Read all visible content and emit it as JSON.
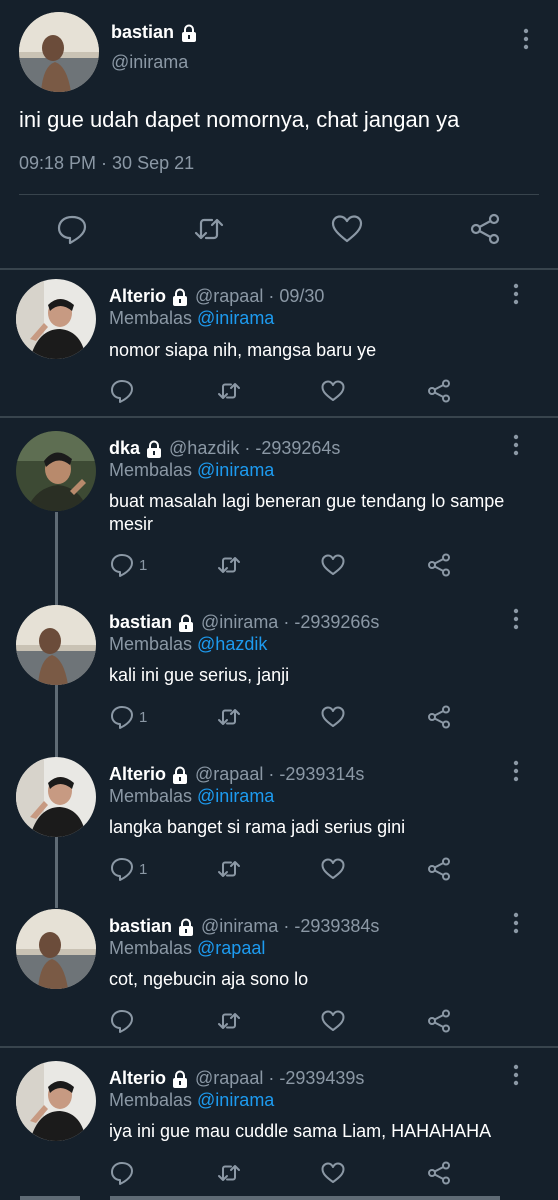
{
  "main_tweet": {
    "name": "bastian",
    "handle": "@inirama",
    "text": "ini gue udah dapet nomornya, chat jangan ya",
    "timestamp": "09:18 PM · 30 Sep 21",
    "icons": [
      "lock-icon",
      "more-icon",
      "reply-icon",
      "retweet-icon",
      "like-icon",
      "share-icon"
    ]
  },
  "replies": [
    {
      "name": "Alterio",
      "handle": "@rapaal",
      "time": "· 09/30",
      "replying_prefix": "Membalas ",
      "replying_to": "@inirama",
      "text_lines": [
        "nomor siapa nih, mangsa baru ye"
      ],
      "reply_count": ""
    },
    {
      "name": "dka",
      "handle": "@hazdik",
      "time": "· -2939264s",
      "replying_prefix": "Membalas ",
      "replying_to": "@inirama",
      "text_lines": [
        "buat masalah lagi beneran gue tendang lo sampe",
        "mesir"
      ],
      "reply_count": "1"
    },
    {
      "name": "bastian",
      "handle": "@inirama",
      "time": "· -2939266s",
      "replying_prefix": "Membalas ",
      "replying_to": "@hazdik",
      "text_lines": [
        "kali ini gue serius, janji"
      ],
      "reply_count": "1"
    },
    {
      "name": "Alterio",
      "handle": "@rapaal",
      "time": "· -2939314s",
      "replying_prefix": "Membalas ",
      "replying_to": "@inirama",
      "text_lines": [
        "langka banget si rama jadi serius gini"
      ],
      "reply_count": "1"
    },
    {
      "name": "bastian",
      "handle": "@inirama",
      "time": "· -2939384s",
      "replying_prefix": "Membalas ",
      "replying_to": "@rapaal",
      "text_lines": [
        "cot, ngebucin aja sono lo"
      ],
      "reply_count": ""
    },
    {
      "name": "Alterio",
      "handle": "@rapaal",
      "time": "· -2939439s",
      "replying_prefix": "Membalas ",
      "replying_to": "@inirama",
      "text_lines": [
        "iya ini gue mau cuddle sama Liam, HAHAHAHA"
      ],
      "reply_count": ""
    }
  ],
  "colors": {
    "background": "#15202b",
    "text": "#ffffff",
    "muted": "#8b98a5",
    "link": "#1d9bf0",
    "divider": "#38444d"
  }
}
